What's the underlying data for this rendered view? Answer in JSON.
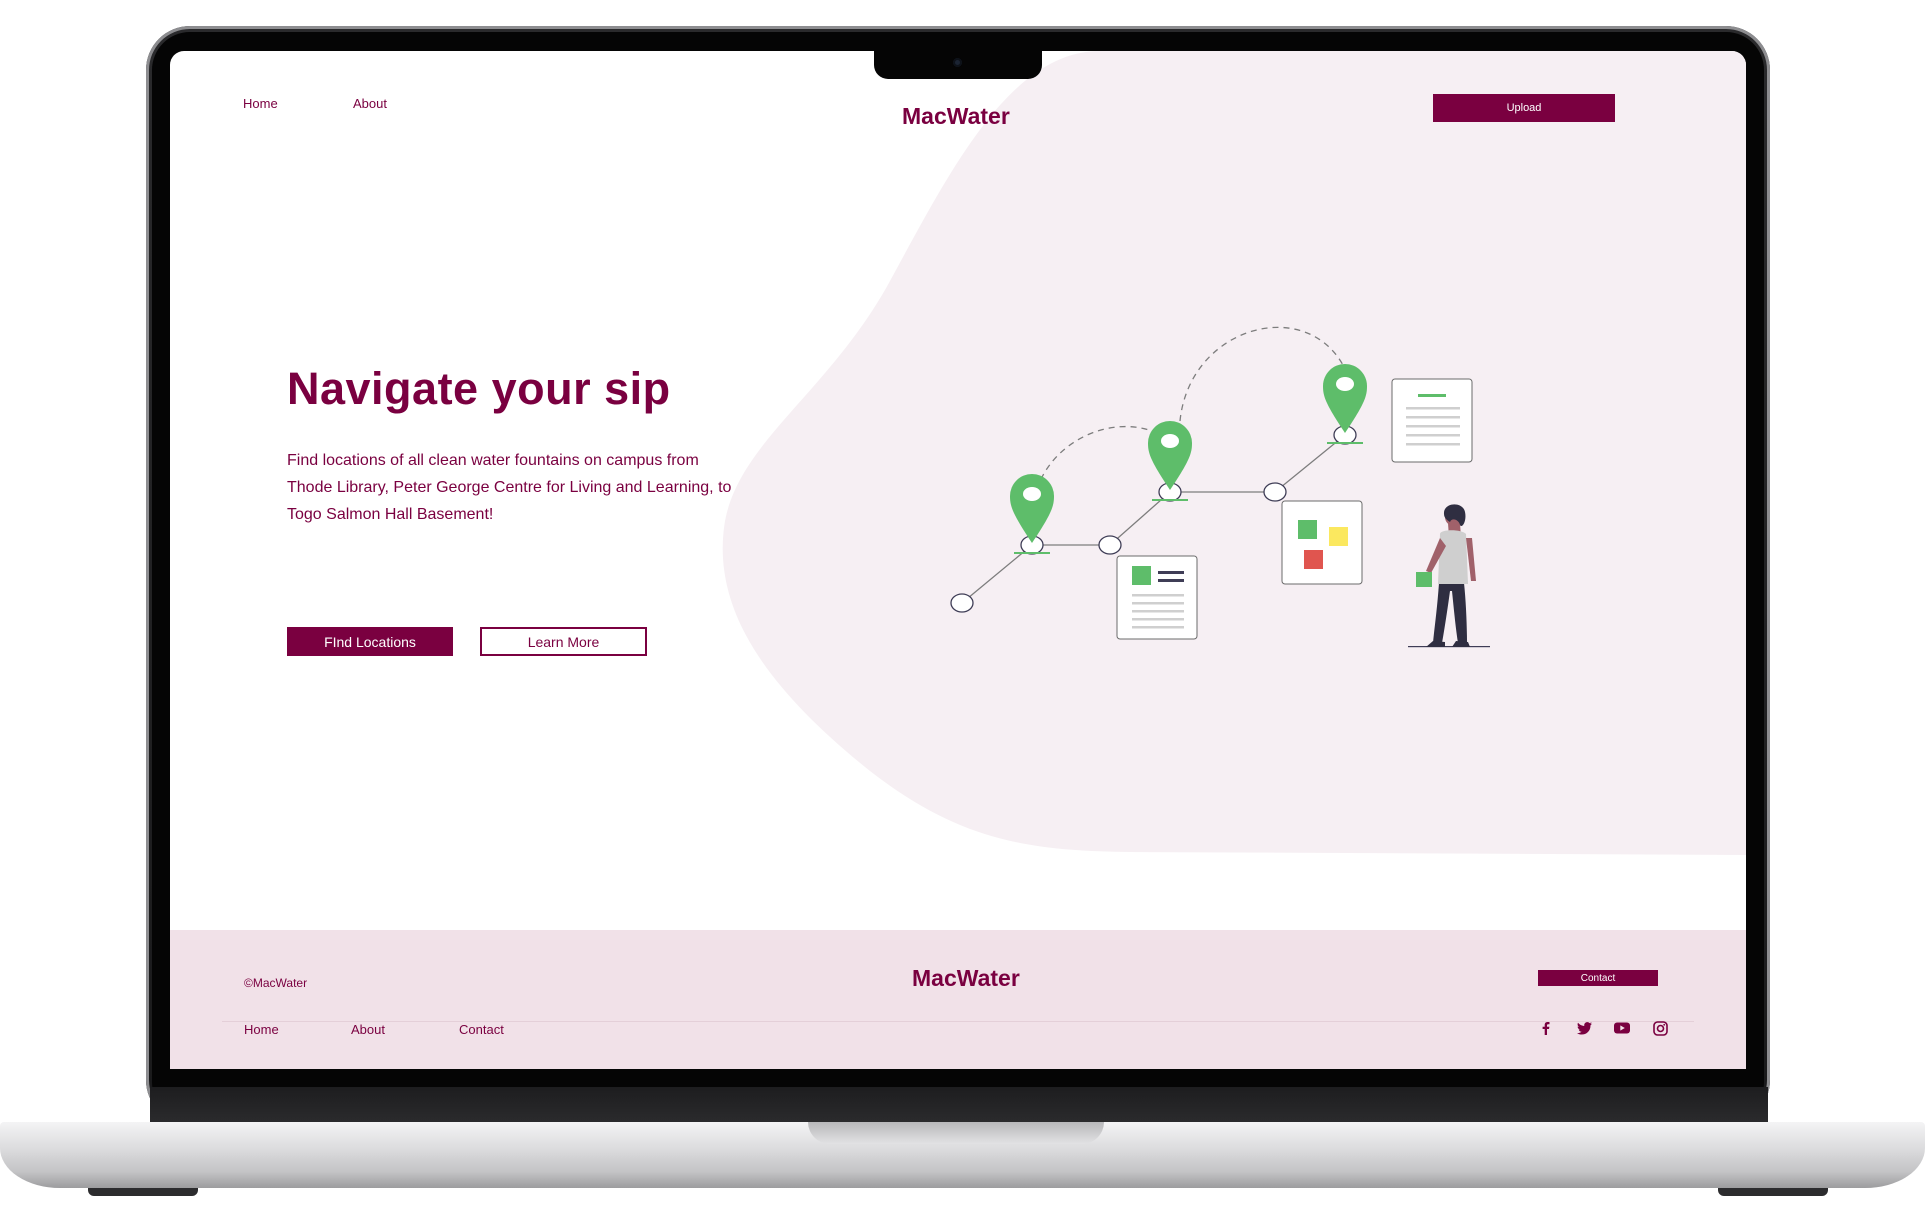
{
  "header": {
    "nav": [
      {
        "label": "Home"
      },
      {
        "label": "About"
      }
    ],
    "brand": "MacWater",
    "upload_label": "Upload"
  },
  "hero": {
    "title": "Navigate your sip",
    "description": "Find locations of all clean water fountains on campus from Thode Library, Peter George Centre for Living and Learning, to Togo Salmon Hall Basement!",
    "primary_button": "FInd Locations",
    "secondary_button": "Learn More"
  },
  "footer": {
    "copyright": "©MacWater",
    "brand": "MacWater",
    "contact_button": "Contact",
    "links": [
      {
        "label": "Home"
      },
      {
        "label": "About"
      },
      {
        "label": "Contact"
      }
    ],
    "social_icons": [
      "facebook-icon",
      "twitter-icon",
      "youtube-icon",
      "instagram-icon"
    ]
  },
  "colors": {
    "brand": "#7a0040",
    "hero_blob": "#f6eff3",
    "footer_bg": "#f1e1e8",
    "pin_green": "#5ebd6a",
    "card_yellow": "#fbe85f",
    "card_red": "#e0554f"
  }
}
